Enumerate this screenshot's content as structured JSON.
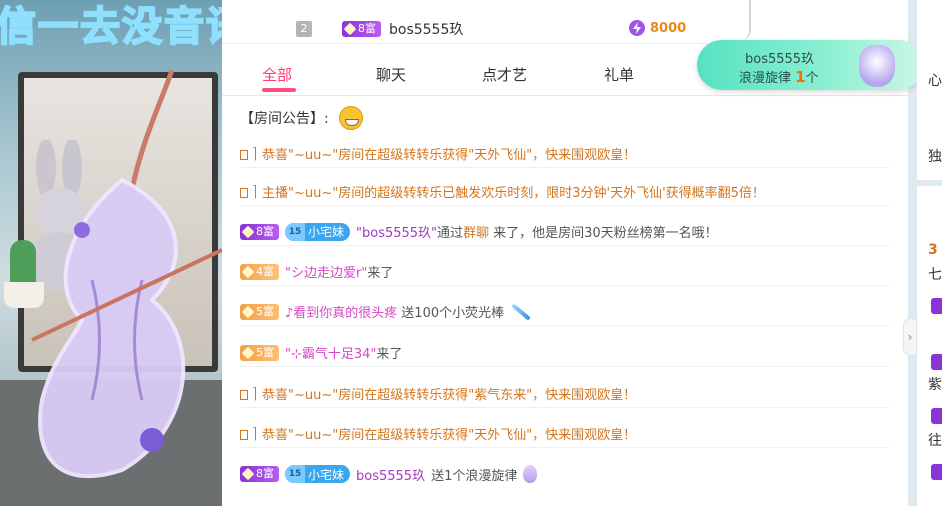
{
  "video": {
    "caption": "信一去没音讯"
  },
  "rank": {
    "number": "2",
    "badge": "8富",
    "name": "bos5555玖",
    "value": "8000"
  },
  "tabs": [
    {
      "label": "全部",
      "active": true
    },
    {
      "label": "聊天",
      "active": false
    },
    {
      "label": "点才艺",
      "active": false
    },
    {
      "label": "礼单",
      "active": false
    }
  ],
  "notice": {
    "label": "【房间公告】:"
  },
  "gift_popup": {
    "name": "bos5555玖",
    "gift": "浪漫旋律",
    "count": "1",
    "unit": "个"
  },
  "messages": [
    {
      "text": "恭喜\"~uu~\"房间在超级转转乐获得\"天外飞仙\"，快来围观欧皇！"
    },
    {
      "text": "主播\"~uu~\"房间的超级转转乐已触发欢乐时刻，限时3分钟'天外飞仙'获得概率翻5倍！"
    },
    {
      "badge": "8富",
      "fan_level": "15",
      "fan_name": "小宅妹",
      "user": "\"bos5555玖\"",
      "pre": "通过",
      "via": "群聊",
      "text": "来了，他是房间30天粉丝榜第一名哦！"
    },
    {
      "badge": "4富",
      "user": "\"シ边走边爱r\"",
      "text": "来了"
    },
    {
      "badge": "5富",
      "user": "♪看到你真的很头疼",
      "text": "送100个小荧光棒"
    },
    {
      "badge": "5富",
      "user": "\"⊹霸气十足34\"",
      "text": "来了"
    },
    {
      "text": "恭喜\"~uu~\"房间在超级转转乐获得\"紫气东来\"，快来围观欧皇！"
    },
    {
      "text": "恭喜\"~uu~\"房间在超级转转乐获得\"天外飞仙\"，快来围观欧皇！"
    },
    {
      "badge": "8富",
      "fan_level": "15",
      "fan_name": "小宅妹",
      "user": "bos5555玖",
      "text": "送1个浪漫旋律"
    }
  ],
  "right_col": {
    "items": [
      "心",
      "独",
      "3",
      "七",
      "紫",
      "往"
    ]
  },
  "colors": {
    "accent": "#ff3c6e",
    "system_text": "#d4761e",
    "badge8": "#8a33d6",
    "fan": "#39a6f0"
  }
}
